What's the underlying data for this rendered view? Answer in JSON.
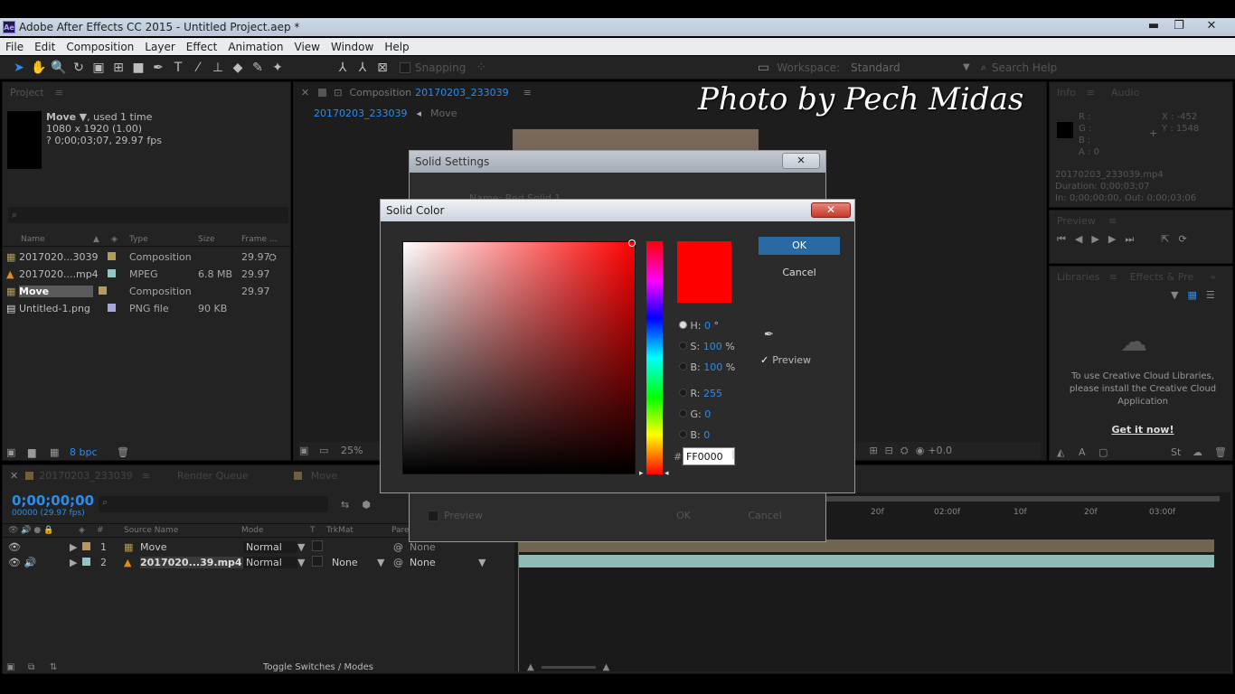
{
  "window": {
    "title": "Adobe After Effects CC 2015 - Untitled Project.aep *",
    "logo": "Ae",
    "minimize": "▬",
    "restore": "❐",
    "close": "✕"
  },
  "menu": [
    "File",
    "Edit",
    "Composition",
    "Layer",
    "Effect",
    "Animation",
    "View",
    "Window",
    "Help"
  ],
  "toolbar": {
    "snapping": "Snapping",
    "workspace_label": "Workspace:",
    "workspace_value": "Standard",
    "search_help": "Search Help"
  },
  "watermark": "Photo by Pech Midas",
  "project": {
    "header": "Project",
    "item_name": "Move",
    "used": ", used 1 time",
    "dims": "1080 x 1920 (1.00)",
    "duration": "? 0;00;03;07, 29.97 fps",
    "columns": {
      "name": "Name",
      "type": "Type",
      "size": "Size",
      "frame": "Frame ..."
    },
    "items": [
      {
        "name": "2017020...3039",
        "type": "Composition",
        "size": "",
        "frame": "29.97",
        "label_color": "#b59a5a"
      },
      {
        "name": "2017020....mp4",
        "type": "MPEG",
        "size": "6.8 MB",
        "frame": "29.97",
        "label_color": "#8fc8c4"
      },
      {
        "name": "Move",
        "type": "Composition",
        "size": "",
        "frame": "29.97",
        "label_color": "#b59a5a"
      },
      {
        "name": "Untitled-1.png",
        "type": "PNG file",
        "size": "90 KB",
        "frame": "",
        "label_color": "#a8a8d8"
      }
    ],
    "bpc": "8 bpc"
  },
  "composition": {
    "header_prefix": "Composition",
    "header_name": "20170203_233039",
    "breadcrumb_a": "20170203_233039",
    "breadcrumb_b": "Move",
    "zoom": "25%",
    "exposure": "+0.0"
  },
  "info": {
    "tabs": [
      "Info",
      "Audio"
    ],
    "r": "R :",
    "g": "G :",
    "b": "B :",
    "a": "A : 0",
    "x": "X : -452",
    "y": "Y : 1548",
    "file": "20170203_233039.mp4",
    "duration": "Duration: 0;00;03;07",
    "inout": "In: 0;00;00;00, Out: 0;00;03;06"
  },
  "preview": {
    "header": "Preview"
  },
  "libraries": {
    "tabs": [
      "Libraries",
      "Effects & Pre"
    ],
    "message": "To use Creative Cloud Libraries, please install the Creative Cloud Application",
    "link": "Get it now!"
  },
  "timeline": {
    "tabs": [
      "20170203_233039",
      "Render Queue",
      "Move"
    ],
    "timecode": "0;00;00;00",
    "timecode_sub": "00000 (29.97 fps)",
    "columns": {
      "source": "Source Name",
      "mode": "Mode",
      "t": "T",
      "trkmat": "TrkMat",
      "parent": "Pare"
    },
    "ruler": [
      "20f",
      "02:00f",
      "10f",
      "20f",
      "03:00f"
    ],
    "layers": [
      {
        "num": "1",
        "name": "Move",
        "mode": "Normal",
        "trkmat": "",
        "parent": "None",
        "color": "#b59a5a"
      },
      {
        "num": "2",
        "name": "2017020...39.mp4",
        "mode": "Normal",
        "trkmat": "None",
        "parent": "None",
        "color": "#8fc8c4"
      }
    ],
    "toggle": "Toggle Switches / Modes"
  },
  "solid_settings": {
    "title": "Solid Settings",
    "name_label": "Name: Red Solid 1",
    "preview": "Preview",
    "ok": "OK",
    "cancel": "Cancel"
  },
  "solid_color": {
    "title": "Solid Color",
    "ok": "OK",
    "cancel": "Cancel",
    "h_label": "H:",
    "h_value": "0",
    "h_unit": "°",
    "s_label": "S:",
    "s_value": "100",
    "s_unit": "%",
    "b_label": "B:",
    "b_value": "100",
    "b_unit": "%",
    "r_label": "R:",
    "r_value": "255",
    "g_label": "G:",
    "g_value": "0",
    "bl_label": "B:",
    "bl_value": "0",
    "hash": "#",
    "hex": "FF0000",
    "preview_label": "Preview",
    "current_color": "#ff0000"
  }
}
